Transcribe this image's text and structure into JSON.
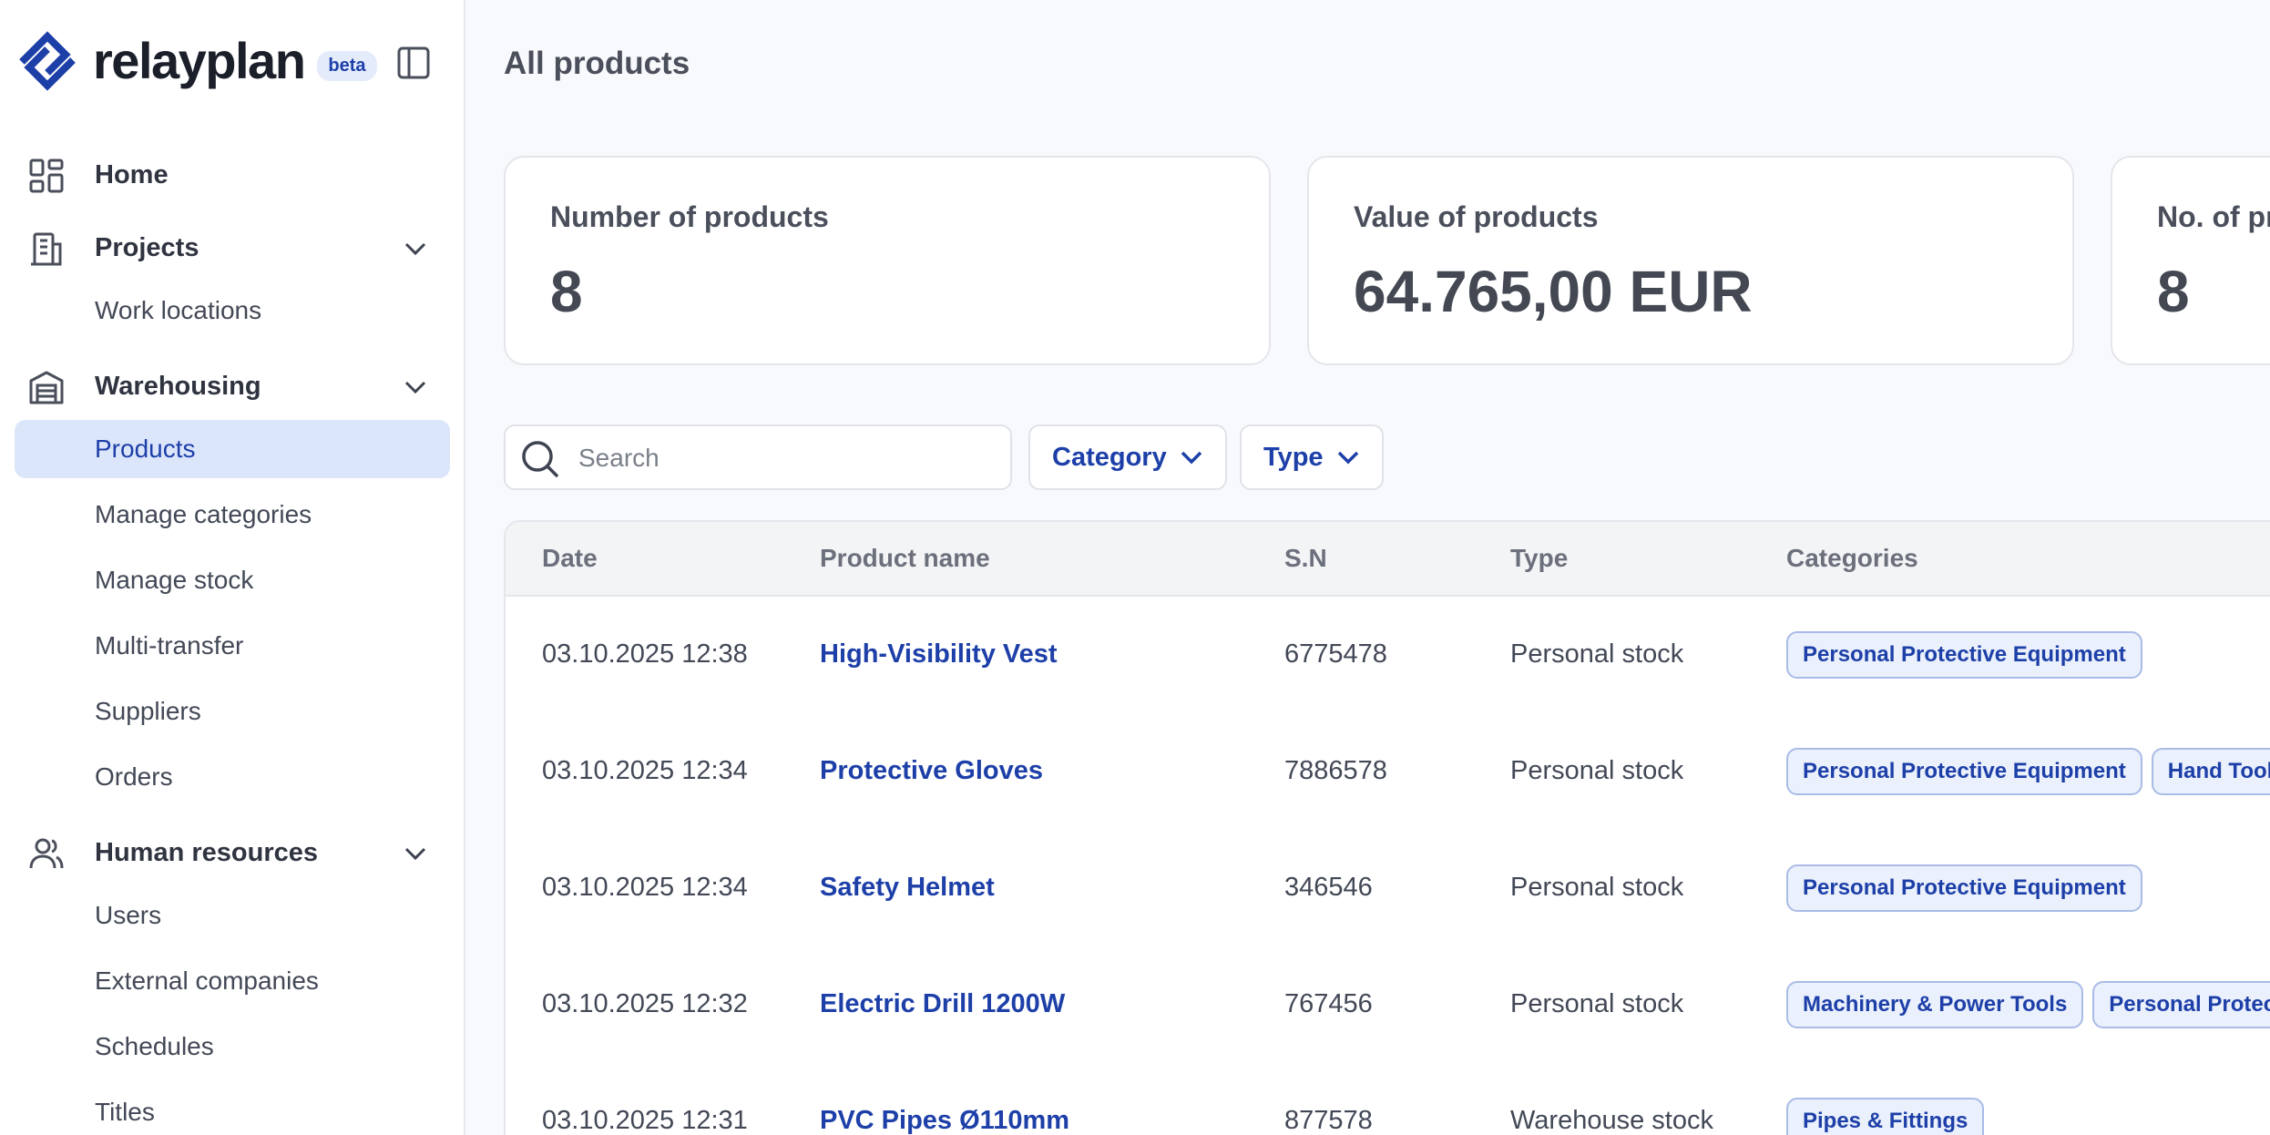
{
  "brand": {
    "name": "relayplan",
    "badge": "beta"
  },
  "sidebar": {
    "home": "Home",
    "projects": {
      "label": "Projects",
      "items": [
        "Work locations"
      ]
    },
    "warehousing": {
      "label": "Warehousing",
      "items": [
        "Products",
        "Manage categories",
        "Manage stock",
        "Multi-transfer",
        "Suppliers",
        "Orders"
      ],
      "active": "Products"
    },
    "human_resources": {
      "label": "Human resources",
      "items": [
        "Users",
        "External companies",
        "Schedules",
        "Titles"
      ]
    }
  },
  "page": {
    "title": "All products"
  },
  "stats": [
    {
      "label": "Number of products",
      "value": "8"
    },
    {
      "label": "Value of products",
      "value": "64.765,00 EUR"
    },
    {
      "label": "No. of pr",
      "value": "8"
    }
  ],
  "filters": {
    "search_placeholder": "Search",
    "category_label": "Category",
    "type_label": "Type"
  },
  "table": {
    "columns": [
      "Date",
      "Product name",
      "S.N",
      "Type",
      "Categories"
    ],
    "rows": [
      {
        "date": "03.10.2025 12:38",
        "name": "High-Visibility Vest",
        "sn": "6775478",
        "type": "Personal stock",
        "categories": [
          "Personal Protective Equipment"
        ]
      },
      {
        "date": "03.10.2025 12:34",
        "name": "Protective Gloves",
        "sn": "7886578",
        "type": "Personal stock",
        "categories": [
          "Personal Protective Equipment",
          "Hand Tool"
        ]
      },
      {
        "date": "03.10.2025 12:34",
        "name": "Safety Helmet",
        "sn": "346546",
        "type": "Personal stock",
        "categories": [
          "Personal Protective Equipment"
        ]
      },
      {
        "date": "03.10.2025 12:32",
        "name": "Electric Drill 1200W",
        "sn": "767456",
        "type": "Personal stock",
        "categories": [
          "Machinery & Power Tools",
          "Personal Protec"
        ]
      },
      {
        "date": "03.10.2025 12:31",
        "name": "PVC Pipes Ø110mm",
        "sn": "877578",
        "type": "Warehouse stock",
        "categories": [
          "Pipes & Fittings"
        ]
      }
    ]
  },
  "colors": {
    "accent": "#1d3fa8",
    "active_bg": "#dce6fb",
    "tag_bg": "#eaf0fc",
    "page_bg": "#f8f9fc"
  }
}
